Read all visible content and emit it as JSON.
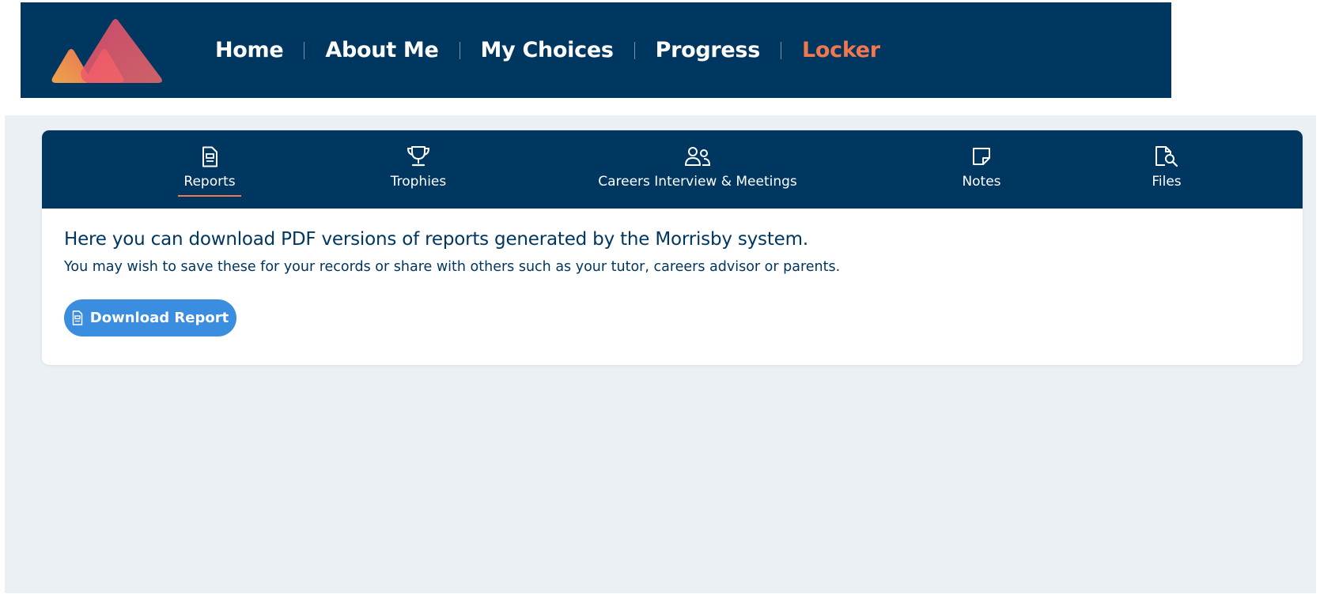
{
  "nav": {
    "items": [
      {
        "label": "Home",
        "active": false
      },
      {
        "label": "About Me",
        "active": false
      },
      {
        "label": "My Choices",
        "active": false
      },
      {
        "label": "Progress",
        "active": false
      },
      {
        "label": "Locker",
        "active": true
      }
    ]
  },
  "tabs": [
    {
      "label": "Reports",
      "icon": "report-icon",
      "active": true
    },
    {
      "label": "Trophies",
      "icon": "trophy-icon",
      "active": false
    },
    {
      "label": "Careers Interview & Meetings",
      "icon": "people-icon",
      "active": false
    },
    {
      "label": "Notes",
      "icon": "note-icon",
      "active": false
    },
    {
      "label": "Files",
      "icon": "file-search-icon",
      "active": false
    }
  ],
  "reports": {
    "headline": "Here you can download PDF versions of reports generated by the Morrisby system.",
    "subline": "You may wish to save these for your records or share with others such as your tutor, careers advisor or parents.",
    "download_label": "Download Report"
  },
  "colors": {
    "navy": "#003760",
    "accent": "#f0774f",
    "button": "#3b8ddf",
    "background": "#ebf0f5"
  }
}
